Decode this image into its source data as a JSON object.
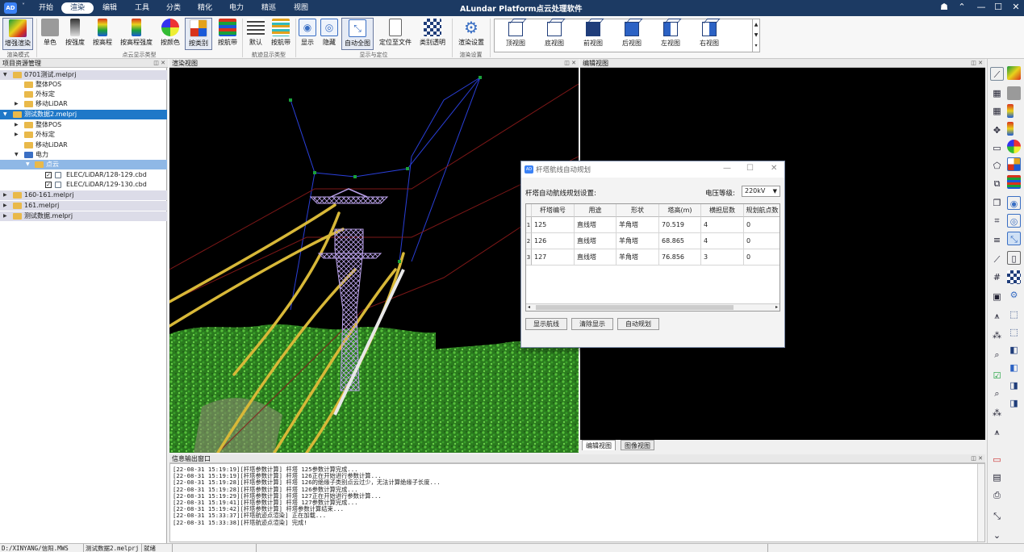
{
  "titlebar": {
    "logo": "AD",
    "quick_access": "˅",
    "menu_tabs": [
      "开始",
      "渲染",
      "编辑",
      "工具",
      "分类",
      "精化",
      "电力",
      "精巡",
      "视图"
    ],
    "active_tab": "渲染",
    "app_title": "ALundar Platform点云处理软件",
    "controls": [
      "☗",
      "⌃",
      "—",
      "☐",
      "✕"
    ]
  },
  "ribbon": {
    "buttons": [
      {
        "label": "增强渲染",
        "icon": "enhanced-render-icon"
      },
      {
        "label": "单色",
        "icon": "single-color-icon"
      },
      {
        "label": "按强度",
        "icon": "by-intensity-icon"
      },
      {
        "label": "按高程",
        "icon": "by-elevation-icon"
      },
      {
        "label": "按高程强度",
        "icon": "by-elevation-intensity-icon"
      },
      {
        "label": "按颜色",
        "icon": "by-color-icon"
      },
      {
        "label": "按类别",
        "icon": "by-class-icon"
      },
      {
        "label": "按航带",
        "icon": "by-strip-icon"
      },
      {
        "label": "默认",
        "icon": "default-track-icon"
      },
      {
        "label": "按航带",
        "icon": "track-by-strip-icon"
      },
      {
        "label": "显示",
        "icon": "show-icon"
      },
      {
        "label": "隐藏",
        "icon": "hide-icon"
      },
      {
        "label": "自动全图",
        "icon": "auto-fit-icon"
      },
      {
        "label": "定位至文件",
        "icon": "locate-file-icon"
      },
      {
        "label": "类别透明",
        "icon": "class-transparent-icon"
      },
      {
        "label": "渲染设置",
        "icon": "render-settings-icon"
      }
    ],
    "group_labels": [
      "渲染模式",
      "点云显示类型",
      "航迹显示类型",
      "显示与定位",
      "渲染设置"
    ],
    "views": [
      "顶视图",
      "底视图",
      "前视图",
      "后视图",
      "左视图",
      "右视图"
    ]
  },
  "tree": {
    "header": "项目资源管理",
    "items": [
      {
        "label": "0701测试.melprj",
        "expander": "▼"
      },
      {
        "label": "整体POS",
        "expander": ""
      },
      {
        "label": "外标定",
        "expander": ""
      },
      {
        "label": "移动LiDAR",
        "expander": "▶"
      },
      {
        "label": "测试数据2.melprj",
        "expander": "▼"
      },
      {
        "label": "整体POS",
        "expander": "▶"
      },
      {
        "label": "外标定",
        "expander": "▶"
      },
      {
        "label": "移动LiDAR",
        "expander": ""
      },
      {
        "label": "电力",
        "expander": "▼"
      },
      {
        "label": "点云",
        "expander": "▼"
      },
      {
        "label": "ELEC/LiDAR/128-129.cbd",
        "expander": "",
        "check": "✓"
      },
      {
        "label": "ELEC/LiDAR/129-130.cbd",
        "expander": "",
        "check": "✓"
      },
      {
        "label": "160-161.melprj",
        "expander": "▶"
      },
      {
        "label": "161.melprj",
        "expander": "▶"
      },
      {
        "label": "测试数据.melprj",
        "expander": "▶"
      }
    ]
  },
  "render_view": {
    "header": "渲染视图"
  },
  "edit_view": {
    "header": "编辑视图",
    "tabs": [
      "编辑视图",
      "图像视图"
    ],
    "active_tab": "编辑视图"
  },
  "output": {
    "header": "信息输出窗口",
    "lines": [
      "[22-08-31 15:19:19][杆塔参数计算] 杆塔 125参数计算完成...",
      "[22-08-31 15:19:19][杆塔参数计算] 杆塔 126正在开始进行参数计算...",
      "[22-08-31 15:19:28][杆塔参数计算] 杆塔 126的绝缘子类别点云过少，无法计算绝缘子长度...",
      "[22-08-31 15:19:28][杆塔参数计算] 杆塔 126参数计算完成...",
      "[22-08-31 15:19:29][杆塔参数计算] 杆塔 127正在开始进行参数计算...",
      "[22-08-31 15:19:41][杆塔参数计算] 杆塔 127参数计算完成...",
      "[22-08-31 15:19:42][杆塔参数计算] 杆塔参数计算结束...",
      "[22-08-31 15:33:37][杆塔航迹点渲染] 正在加载...",
      "[22-08-31 15:33:38][杆塔航迹点渲染] 完成!"
    ]
  },
  "dialog": {
    "title": "杆塔航线自动规划",
    "settings_label": "杆塔自动航线规划设置:",
    "voltage_label": "电压等级:",
    "voltage_value": "220kV",
    "columns": [
      "杆塔编号",
      "用途",
      "形状",
      "塔高(m)",
      "横担层数",
      "规划航点数"
    ],
    "rows": [
      {
        "idx": "1",
        "tower": "125",
        "use": "直线塔",
        "shape": "羊角塔",
        "height": "70.519",
        "layers": "4",
        "points": "0"
      },
      {
        "idx": "2",
        "tower": "126",
        "use": "直线塔",
        "shape": "羊角塔",
        "height": "68.865",
        "layers": "4",
        "points": "0"
      },
      {
        "idx": "3",
        "tower": "127",
        "use": "直线塔",
        "shape": "羊角塔",
        "height": "76.856",
        "layers": "3",
        "points": "0"
      }
    ],
    "buttons": [
      "显示航线",
      "清除显示",
      "自动规划"
    ]
  },
  "statusbar": {
    "path": "D:/XINYANG/信阳.MWS",
    "project": "测试数据2.melprj",
    "state": "就绪"
  },
  "colors": {
    "titlebar": "#1c3a63",
    "selection": "#1f78c8",
    "tower": "#b9a1e8",
    "wire": "#d8b838",
    "route": "#2a3fd8",
    "vegetation": "#3a9a2a"
  }
}
